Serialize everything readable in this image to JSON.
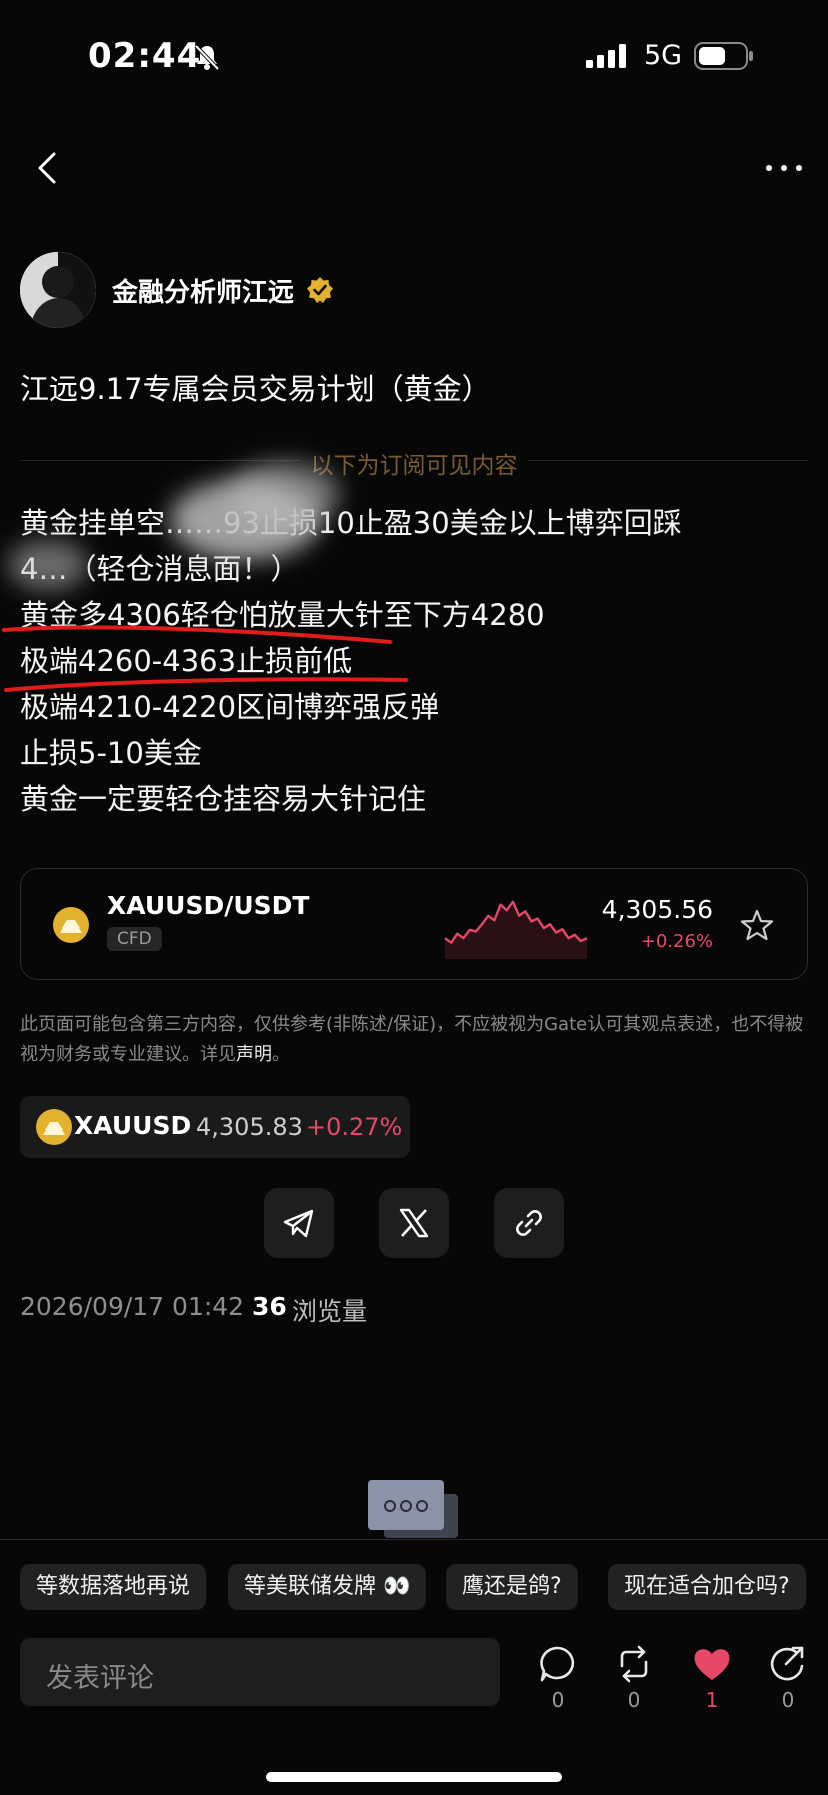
{
  "status_bar": {
    "time": "02:44",
    "network": "5G"
  },
  "author": {
    "name": "金融分析师江远"
  },
  "post": {
    "title": "江远9.17专属会员交易计划（黄金）",
    "subscriber_label": "以下为订阅可见内容",
    "lines": [
      "黄金挂单空……93止损10止盈30美金以上博弈回踩",
      "4…（轻仓消息面！）",
      "黄金多4306轻仓怕放量大针至下方4280",
      "极端4260-4363止损前低",
      "极端4210-4220区间博弈强反弹",
      "止损5-10美金",
      "黄金一定要轻仓挂容易大针记住"
    ]
  },
  "asset_card": {
    "symbol": "XAUUSD/USDT",
    "badge": "CFD",
    "price": "4,305.56",
    "change": "+0.26%",
    "trend_color": "#e84867",
    "sparkline": [
      0.3,
      0.22,
      0.38,
      0.3,
      0.45,
      0.42,
      0.55,
      0.7,
      0.62,
      0.9,
      0.8,
      0.95,
      0.7,
      0.78,
      0.6,
      0.65,
      0.48,
      0.55,
      0.4,
      0.46,
      0.3,
      0.36,
      0.25,
      0.3
    ]
  },
  "disclaimer": {
    "text": "此页面可能包含第三方内容，仅供参考(非陈述/保证)，不应被视为Gate认可其观点表述，也不得被视为财务或专业建议。详见",
    "link": "声明",
    "end": "。"
  },
  "ticker_chip": {
    "symbol": "XAUUSD",
    "price": "4,305.83",
    "change": "+0.27%"
  },
  "share_buttons": [
    {
      "icon": "telegram-icon"
    },
    {
      "icon": "x-icon"
    },
    {
      "icon": "link-icon"
    }
  ],
  "meta": {
    "date": "2026/09/17 01:42",
    "views": "36",
    "views_label": "浏览量"
  },
  "quick_replies": [
    "等数据落地再说",
    "等美联储发牌 👀",
    "鹰还是鸽?",
    "现在适合加仓吗?"
  ],
  "comment": {
    "placeholder": "发表评论"
  },
  "actions": [
    {
      "icon": "comment-icon",
      "count": "0"
    },
    {
      "icon": "repost-icon",
      "count": "0"
    },
    {
      "icon": "like-icon",
      "count": "1"
    },
    {
      "icon": "share-icon",
      "count": "0"
    }
  ],
  "colors": {
    "accent_red": "#e84867",
    "gold": "#e2b12d",
    "subscriber_label": "#7a5a2e"
  }
}
